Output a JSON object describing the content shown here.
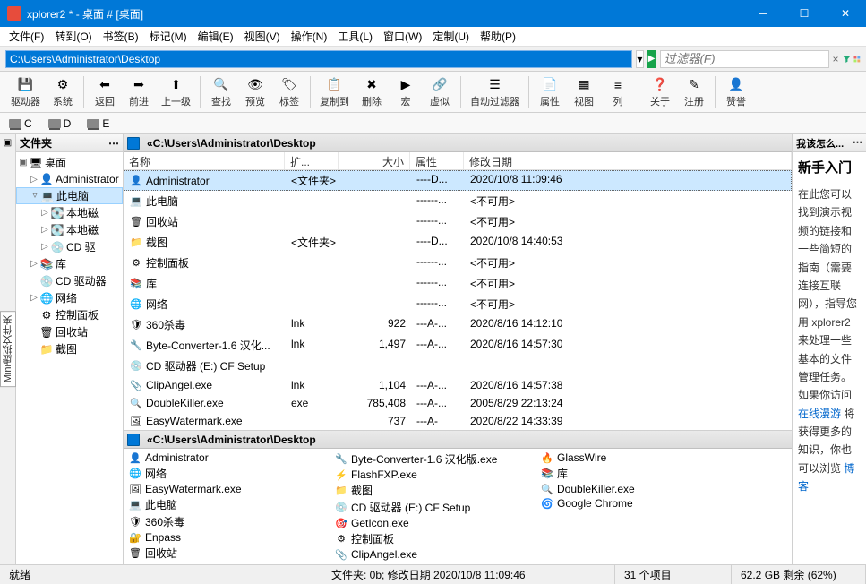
{
  "window": {
    "title": "xplorer2 * - 桌面 # [桌面]"
  },
  "menu": [
    "文件(F)",
    "转到(O)",
    "书签(B)",
    "标记(M)",
    "编辑(E)",
    "视图(V)",
    "操作(N)",
    "工具(L)",
    "窗口(W)",
    "定制(U)",
    "帮助(P)"
  ],
  "address": {
    "path": "C:\\Users\\Administrator\\Desktop",
    "filter_placeholder": "过滤器(F)"
  },
  "toolbar": [
    {
      "icon": "💾",
      "label": "驱动器",
      "name": "drives"
    },
    {
      "icon": "⚙",
      "label": "系统",
      "name": "system"
    },
    {
      "sep": true
    },
    {
      "icon": "⬅",
      "label": "返回",
      "name": "back"
    },
    {
      "icon": "➡",
      "label": "前进",
      "name": "forward"
    },
    {
      "icon": "⬆",
      "label": "上一级",
      "name": "up"
    },
    {
      "sep": true
    },
    {
      "icon": "🔍",
      "label": "查找",
      "name": "find"
    },
    {
      "icon": "👁",
      "label": "预览",
      "name": "preview"
    },
    {
      "icon": "🏷",
      "label": "标签",
      "name": "tags"
    },
    {
      "sep": true
    },
    {
      "icon": "📋",
      "label": "复制到",
      "name": "copyto"
    },
    {
      "icon": "✖",
      "label": "删除",
      "name": "delete"
    },
    {
      "icon": "▶",
      "label": "宏",
      "name": "macro"
    },
    {
      "icon": "🔗",
      "label": "虚似",
      "name": "virtual"
    },
    {
      "sep": true
    },
    {
      "icon": "☰",
      "label": "自动过滤器",
      "name": "autofilter"
    },
    {
      "sep": true
    },
    {
      "icon": "📄",
      "label": "属性",
      "name": "props"
    },
    {
      "icon": "▦",
      "label": "视图",
      "name": "view"
    },
    {
      "icon": "≡",
      "label": "列",
      "name": "columns"
    },
    {
      "sep": true
    },
    {
      "icon": "❓",
      "label": "关于",
      "name": "about"
    },
    {
      "icon": "✎",
      "label": "注册",
      "name": "register"
    },
    {
      "sep": true
    },
    {
      "icon": "👤",
      "label": "赞誉",
      "name": "credits"
    }
  ],
  "drives": [
    "C",
    "D",
    "E"
  ],
  "sidebar": {
    "header": "文件夹",
    "vtab_label": "Mini虚拟文件夹",
    "tree": [
      {
        "indent": 0,
        "tw": "▣",
        "icon": "🖥",
        "label": "桌面"
      },
      {
        "indent": 1,
        "tw": "▷",
        "icon": "👤",
        "label": "Administrator"
      },
      {
        "indent": 1,
        "tw": "▿",
        "icon": "💻",
        "label": "此电脑",
        "selected": true
      },
      {
        "indent": 2,
        "tw": "▷",
        "icon": "💽",
        "label": "本地磁"
      },
      {
        "indent": 2,
        "tw": "▷",
        "icon": "💽",
        "label": "本地磁"
      },
      {
        "indent": 2,
        "tw": "▷",
        "icon": "💿",
        "label": "CD 驱"
      },
      {
        "indent": 1,
        "tw": "▷",
        "icon": "📚",
        "label": "库"
      },
      {
        "indent": 1,
        "tw": "",
        "icon": "💿",
        "label": "CD 驱动器"
      },
      {
        "indent": 1,
        "tw": "▷",
        "icon": "🌐",
        "label": "网络"
      },
      {
        "indent": 1,
        "tw": "",
        "icon": "⚙",
        "label": "控制面板"
      },
      {
        "indent": 1,
        "tw": "",
        "icon": "🗑",
        "label": "回收站"
      },
      {
        "indent": 1,
        "tw": "",
        "icon": "📁",
        "label": "截图"
      }
    ]
  },
  "pane_path_label": "«C:\\Users\\Administrator\\Desktop",
  "columns": {
    "name": "名称",
    "ext": "扩...",
    "size": "大小",
    "attr": "属性",
    "date": "修改日期"
  },
  "filesTop": [
    {
      "icon": "👤",
      "name": "Administrator",
      "ext": "<文件夹>",
      "size": "",
      "attr": "----D...",
      "date": "2020/10/8 11:09:46",
      "selected": true
    },
    {
      "icon": "💻",
      "name": "此电脑",
      "ext": "",
      "size": "",
      "attr": "------...",
      "date": "<不可用>"
    },
    {
      "icon": "🗑",
      "name": "回收站",
      "ext": "",
      "size": "",
      "attr": "------...",
      "date": "<不可用>"
    },
    {
      "icon": "📁",
      "name": "截图",
      "ext": "<文件夹>",
      "size": "",
      "attr": "----D...",
      "date": "2020/10/8 14:40:53"
    },
    {
      "icon": "⚙",
      "name": "控制面板",
      "ext": "",
      "size": "",
      "attr": "------...",
      "date": "<不可用>"
    },
    {
      "icon": "📚",
      "name": "库",
      "ext": "",
      "size": "",
      "attr": "------...",
      "date": "<不可用>"
    },
    {
      "icon": "🌐",
      "name": "网络",
      "ext": "",
      "size": "",
      "attr": "------...",
      "date": "<不可用>"
    },
    {
      "icon": "🛡",
      "name": "360杀毒",
      "ext": "lnk",
      "size": "922",
      "attr": "---A-...",
      "date": "2020/8/16 14:12:10"
    },
    {
      "icon": "🔧",
      "name": "Byte-Converter-1.6 汉化...",
      "ext": "lnk",
      "size": "1,497",
      "attr": "---A-...",
      "date": "2020/8/16 14:57:30"
    },
    {
      "icon": "💿",
      "name": "CD 驱动器 (E:) CF Setup",
      "ext": "",
      "size": "",
      "attr": "",
      "date": ""
    },
    {
      "icon": "📎",
      "name": "ClipAngel.exe",
      "ext": "lnk",
      "size": "1,104",
      "attr": "---A-...",
      "date": "2020/8/16 14:57:38"
    },
    {
      "icon": "🔍",
      "name": "DoubleKiller.exe",
      "ext": "exe",
      "size": "785,408",
      "attr": "---A-...",
      "date": "2005/8/29 22:13:24"
    },
    {
      "icon": "🖼",
      "name": "EasyWatermark.exe",
      "ext": "",
      "size": "737",
      "attr": "---A-",
      "date": "2020/8/22 14:33:39"
    }
  ],
  "filesBottom": [
    [
      {
        "icon": "👤",
        "name": "Administrator"
      },
      {
        "icon": "🌐",
        "name": "网络"
      },
      {
        "icon": "🖼",
        "name": "EasyWatermark.exe"
      }
    ],
    [
      {
        "icon": "💻",
        "name": "此电脑"
      },
      {
        "icon": "🛡",
        "name": "360杀毒"
      },
      {
        "icon": "🔐",
        "name": "Enpass"
      }
    ],
    [
      {
        "icon": "🗑",
        "name": "回收站"
      },
      {
        "icon": "🔧",
        "name": "Byte-Converter-1.6 汉化版.exe"
      },
      {
        "icon": "⚡",
        "name": "FlashFXP.exe"
      }
    ],
    [
      {
        "icon": "📁",
        "name": "截图"
      },
      {
        "icon": "💿",
        "name": "CD 驱动器 (E:) CF Setup"
      },
      {
        "icon": "🎯",
        "name": "GetIcon.exe"
      }
    ],
    [
      {
        "icon": "⚙",
        "name": "控制面板"
      },
      {
        "icon": "📎",
        "name": "ClipAngel.exe"
      },
      {
        "icon": "🔥",
        "name": "GlassWire"
      }
    ],
    [
      {
        "icon": "📚",
        "name": "库"
      },
      {
        "icon": "🔍",
        "name": "DoubleKiller.exe"
      },
      {
        "icon": "🌀",
        "name": "Google Chrome"
      }
    ]
  ],
  "rightpanel": {
    "header": "我该怎么...",
    "title": "新手入门",
    "text": "在此您可以找到演示视频的链接和一些简短的指南（需要连接互联网），指导您用 xplorer2 来处理一些基本的文件管理任务。如果你访问",
    "link1": "在线漫游",
    "text2": "将获得更多的知识，你也可以浏览",
    "link2": "博客"
  },
  "statusbar": {
    "ready": "就绪",
    "detail": "文件夹: 0b; 修改日期 2020/10/8 11:09:46",
    "count": "31 个项目",
    "space": "62.2 GB 剩余 (62%)"
  }
}
